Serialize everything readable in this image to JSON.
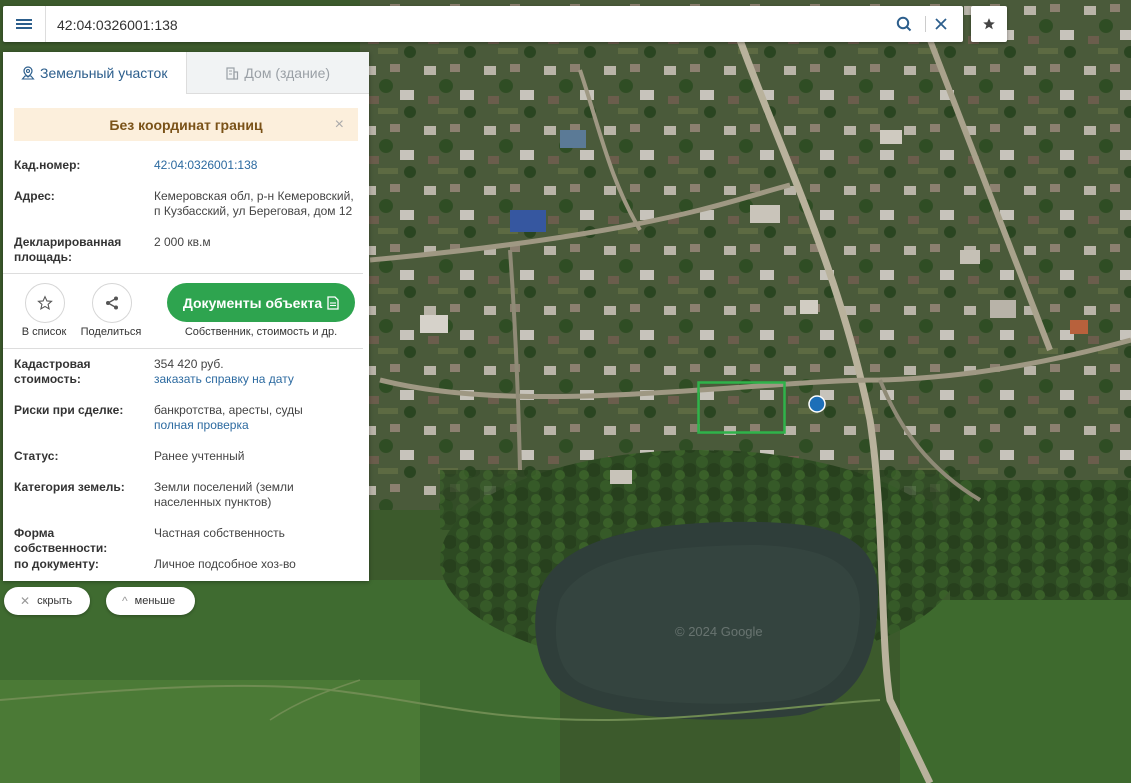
{
  "search": {
    "value": "42:04:0326001:138"
  },
  "tabs": [
    {
      "label": "Земельный участок",
      "active": true
    },
    {
      "label": "Дом (здание)",
      "active": false
    }
  ],
  "warning": {
    "text": "Без координат границ"
  },
  "info": {
    "cadastral_number_label": "Кад.номер:",
    "cadastral_number_value": "42:04:0326001:138",
    "address_label": "Адрес:",
    "address_value": "Кемеровская обл, р-н Кемеровский, п Кузбасский, ул Береговая, дом 12",
    "declared_area_label": "Декларированная площадь:",
    "declared_area_value": "2 000 кв.м"
  },
  "actions": {
    "to_list_label": "В список",
    "share_label": "Поделиться",
    "documents_button": "Документы объекта",
    "documents_subtitle": "Собственник, стоимость и др."
  },
  "details": {
    "cadastral_value_label": "Кадастровая стоимость:",
    "cadastral_value": "354 420 руб.",
    "order_certificate_link": "заказать справку на дату",
    "risks_label": "Риски при сделке:",
    "risks_value": "банкротства, аресты, суды",
    "full_check_link": "полная проверка",
    "status_label": "Статус:",
    "status_value": "Ранее учтенный",
    "land_category_label": "Категория земель:",
    "land_category_value": "Земли поселений (земли населенных пунктов)",
    "ownership_label": "Форма собственности:",
    "ownership_value": "Частная собственность",
    "by_document_label": "по документу:",
    "by_document_value": "Личное подсобное хоз-во"
  },
  "bottom": {
    "hide_label": "скрыть",
    "less_label": "меньше"
  },
  "map": {
    "copyright": "© 2024 Google"
  },
  "colors": {
    "accent": "#2c5e8c",
    "green": "#2ea44f",
    "warning_bg": "#fcefdc"
  }
}
